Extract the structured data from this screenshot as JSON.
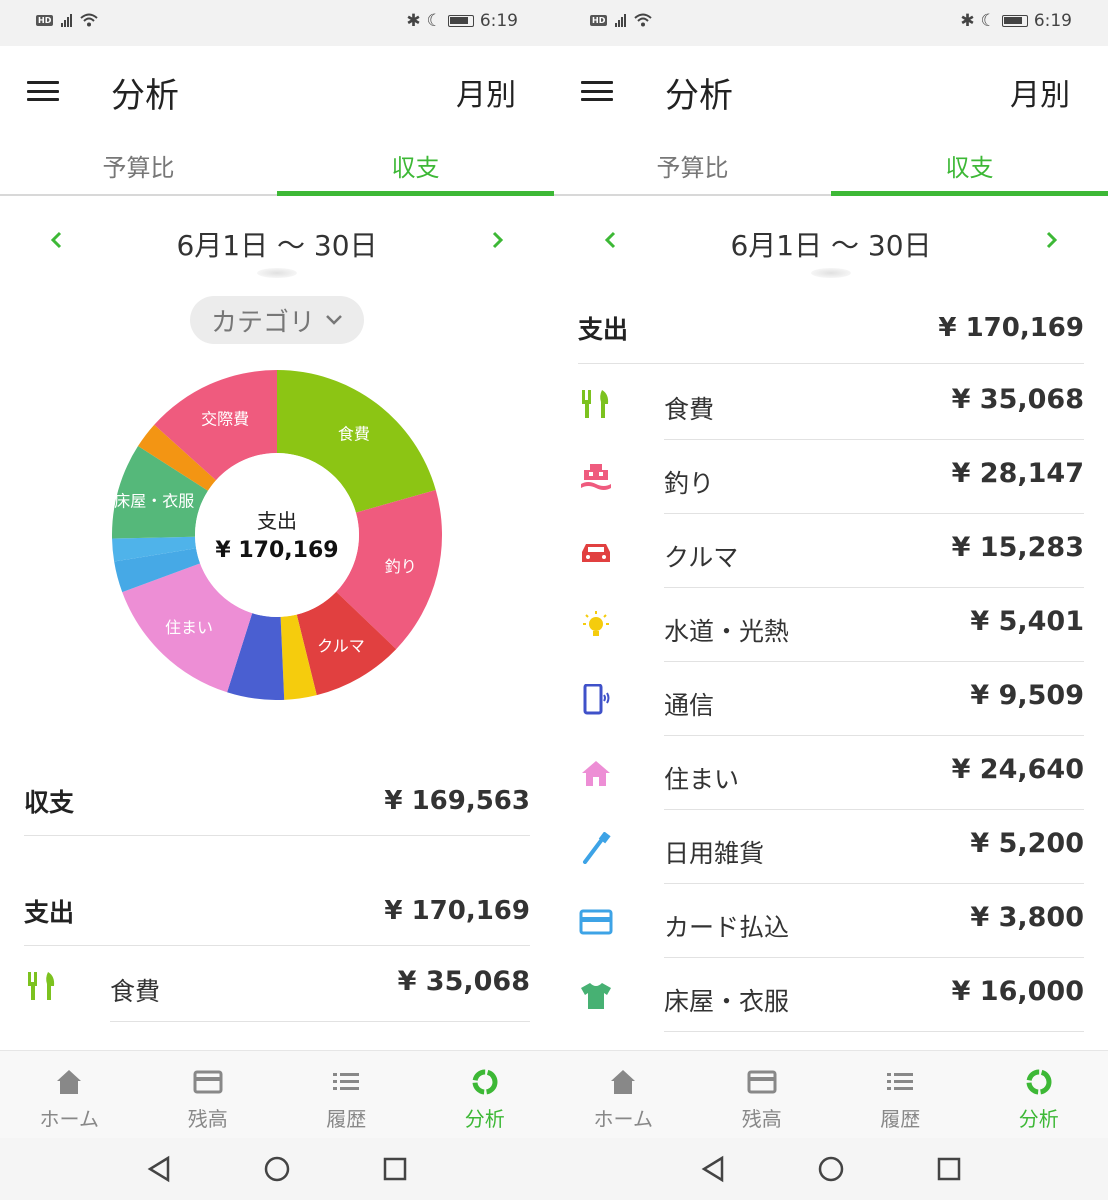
{
  "screens": [
    {
      "status": {
        "hd": "HD",
        "time": "6:19"
      },
      "header": {
        "title": "分析",
        "mode": "月別"
      },
      "tabs": [
        {
          "label": "予算比"
        },
        {
          "label": "収支"
        }
      ],
      "period": {
        "label": "6月1日 〜 30日"
      },
      "category_filter": "カテゴリ",
      "donut": {
        "center_caption": "支出",
        "center_value": "¥ 170,169",
        "segments": [
          {
            "label": "食費",
            "value": 35068,
            "color": "#8cc514"
          },
          {
            "label": "釣り",
            "value": 28147,
            "color": "#ef5b7e"
          },
          {
            "label": "クルマ",
            "value": 15283,
            "color": "#e14040"
          },
          {
            "label": "",
            "value": 5401,
            "color": "#f5cc0d"
          },
          {
            "label": "",
            "value": 9509,
            "color": "#4a5fd1"
          },
          {
            "label": "住まい",
            "value": 24640,
            "color": "#ed8ed5"
          },
          {
            "label": "",
            "value": 5200,
            "color": "#46a9e6"
          },
          {
            "label": "",
            "value": 3800,
            "color": "#4fb3ea"
          },
          {
            "label": "床屋・衣服",
            "value": 16000,
            "color": "#55b87a"
          },
          {
            "label": "",
            "value": 4400,
            "color": "#f39513"
          },
          {
            "label": "交際費",
            "value": 22721,
            "color": "#ef5b7e"
          }
        ]
      },
      "balance": {
        "label": "収支",
        "value": "¥ 169,563"
      },
      "expense": {
        "label": "支出",
        "value": "¥ 170,169"
      },
      "categories": [
        {
          "name": "食費",
          "value": "¥ 35,068",
          "icon": "fork-knife-icon",
          "color": "#7cc21f"
        }
      ],
      "nav": [
        {
          "label": "ホーム",
          "icon": "home-icon"
        },
        {
          "label": "残高",
          "icon": "card-icon"
        },
        {
          "label": "履歴",
          "icon": "list-icon"
        },
        {
          "label": "分析",
          "icon": "analysis-icon"
        }
      ]
    },
    {
      "status": {
        "hd": "HD",
        "time": "6:19"
      },
      "header": {
        "title": "分析",
        "mode": "月別"
      },
      "tabs": [
        {
          "label": "予算比"
        },
        {
          "label": "収支"
        }
      ],
      "period": {
        "label": "6月1日 〜 30日"
      },
      "expense": {
        "label": "支出",
        "value": "¥ 170,169"
      },
      "categories": [
        {
          "name": "食費",
          "value": "¥ 35,068",
          "icon": "fork-knife-icon",
          "color": "#7cc21f"
        },
        {
          "name": "釣り",
          "value": "¥ 28,147",
          "icon": "boat-icon",
          "color": "#ef5b7e"
        },
        {
          "name": "クルマ",
          "value": "¥ 15,283",
          "icon": "car-icon",
          "color": "#e14040"
        },
        {
          "name": "水道・光熱",
          "value": "¥ 5,401",
          "icon": "lightbulb-icon",
          "color": "#f5cc0d"
        },
        {
          "name": "通信",
          "value": "¥ 9,509",
          "icon": "phone-icon",
          "color": "#3f51c9"
        },
        {
          "name": "住まい",
          "value": "¥ 24,640",
          "icon": "house-icon",
          "color": "#ed8ed5"
        },
        {
          "name": "日用雑貨",
          "value": "¥ 5,200",
          "icon": "toothbrush-icon",
          "color": "#3da3e6"
        },
        {
          "name": "カード払込",
          "value": "¥ 3,800",
          "icon": "credit-card-icon",
          "color": "#3da3e6"
        },
        {
          "name": "床屋・衣服",
          "value": "¥ 16,000",
          "icon": "shirt-icon",
          "color": "#47b173"
        }
      ],
      "nav": [
        {
          "label": "ホーム",
          "icon": "home-icon"
        },
        {
          "label": "残高",
          "icon": "card-icon"
        },
        {
          "label": "履歴",
          "icon": "list-icon"
        },
        {
          "label": "分析",
          "icon": "analysis-icon"
        }
      ]
    }
  ],
  "theme": {
    "accent": "#3db836"
  }
}
